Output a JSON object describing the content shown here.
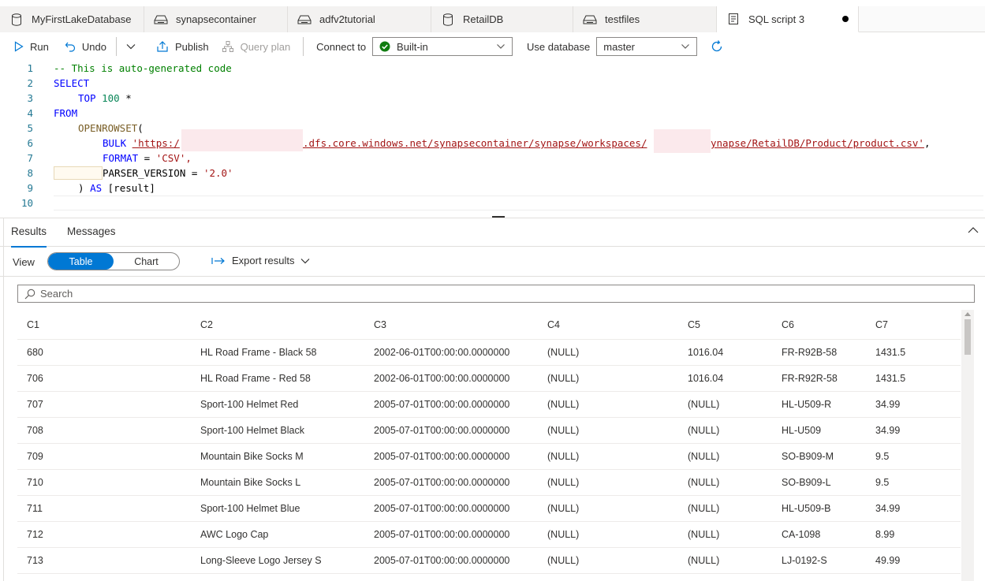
{
  "tabs": [
    {
      "label": "MyFirstLakeDatabase",
      "icon": "database-icon"
    },
    {
      "label": "synapsecontainer",
      "icon": "storage-icon"
    },
    {
      "label": "adfv2tutorial",
      "icon": "storage-icon"
    },
    {
      "label": "RetailDB",
      "icon": "database-icon"
    },
    {
      "label": "testfiles",
      "icon": "storage-icon"
    },
    {
      "label": "SQL script 3",
      "icon": "script-icon",
      "active": true,
      "unsaved": true
    }
  ],
  "toolbar": {
    "run": "Run",
    "undo": "Undo",
    "publish": "Publish",
    "query_plan": "Query plan",
    "connect_to_label": "Connect to",
    "connect_to_value": "Built-in",
    "use_database_label": "Use database",
    "use_database_value": "master"
  },
  "editor": {
    "line_numbers": [
      "1",
      "2",
      "3",
      "4",
      "5",
      "6",
      "7",
      "8",
      "9",
      "10"
    ],
    "l1": "-- This is auto-generated code",
    "l2": "SELECT",
    "l3_kw": "TOP",
    "l3_num": "100",
    "l3_rest": " *",
    "l4": "FROM",
    "l5_fn": "OPENROWSET",
    "l5_rest": "(",
    "l6_kw": "BULK",
    "l6_str_a": "'https:/",
    "l6_str_b": ".dfs.core.windows.net/synapsecontainer/synapse/workspaces/",
    "l6_str_c": "ynapse/RetailDB/Product/product.csv'",
    "l6_end": ",",
    "l7_kw": "FORMAT",
    "l7_eq": " = ",
    "l7_str": "'CSV',",
    "l8_a": "PARSER_VERSION = ",
    "l8_str": "'2.0'",
    "l9_a": ") ",
    "l9_kw": "AS",
    "l9_b": " [result]"
  },
  "results": {
    "tab_results": "Results",
    "tab_messages": "Messages",
    "view_label": "View",
    "view_table": "Table",
    "view_chart": "Chart",
    "export": "Export results",
    "search_placeholder": "Search",
    "columns": [
      "C1",
      "C2",
      "C3",
      "C4",
      "C5",
      "C6",
      "C7"
    ],
    "rows": [
      [
        "680",
        "HL Road Frame - Black 58",
        "2002-06-01T00:00:00.0000000",
        "(NULL)",
        "1016.04",
        "FR-R92B-58",
        "1431.5"
      ],
      [
        "706",
        "HL Road Frame - Red 58",
        "2002-06-01T00:00:00.0000000",
        "(NULL)",
        "1016.04",
        "FR-R92R-58",
        "1431.5"
      ],
      [
        "707",
        "Sport-100 Helmet Red",
        "2005-07-01T00:00:00.0000000",
        "(NULL)",
        "(NULL)",
        "HL-U509-R",
        "34.99"
      ],
      [
        "708",
        "Sport-100 Helmet Black",
        "2005-07-01T00:00:00.0000000",
        "(NULL)",
        "(NULL)",
        "HL-U509",
        "34.99"
      ],
      [
        "709",
        "Mountain Bike Socks M",
        "2005-07-01T00:00:00.0000000",
        "(NULL)",
        "(NULL)",
        "SO-B909-M",
        "9.5"
      ],
      [
        "710",
        "Mountain Bike Socks L",
        "2005-07-01T00:00:00.0000000",
        "(NULL)",
        "(NULL)",
        "SO-B909-L",
        "9.5"
      ],
      [
        "711",
        "Sport-100 Helmet Blue",
        "2005-07-01T00:00:00.0000000",
        "(NULL)",
        "(NULL)",
        "HL-U509-B",
        "34.99"
      ],
      [
        "712",
        "AWC Logo Cap",
        "2005-07-01T00:00:00.0000000",
        "(NULL)",
        "(NULL)",
        "CA-1098",
        "8.99"
      ],
      [
        "713",
        "Long-Sleeve Logo Jersey S",
        "2005-07-01T00:00:00.0000000",
        "(NULL)",
        "(NULL)",
        "LJ-0192-S",
        "49.99"
      ]
    ]
  },
  "colors": {
    "accent": "#0078d4",
    "keyword": "#0000ff",
    "string": "#a31515",
    "comment": "#008000",
    "success": "#107c10"
  }
}
